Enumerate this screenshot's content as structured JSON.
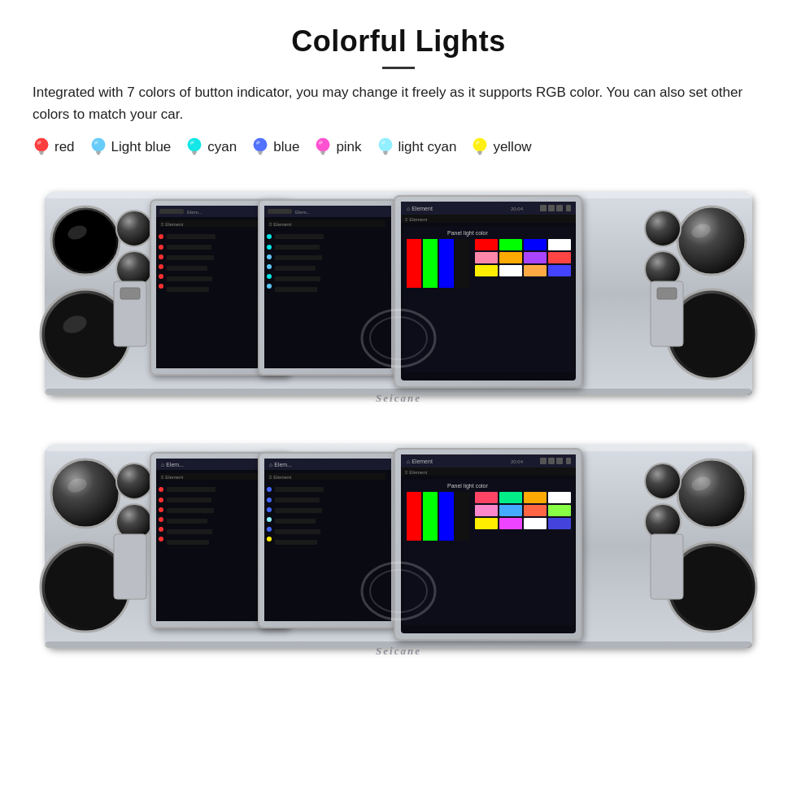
{
  "header": {
    "title": "Colorful Lights",
    "description": "Integrated with 7 colors of button indicator, you may change it freely as it supports RGB color. You can also set other colors to match your car."
  },
  "colors": [
    {
      "name": "red",
      "color": "#ff2020",
      "bulb_color": "#ff3030"
    },
    {
      "name": "Light blue",
      "color": "#5bc8fa",
      "bulb_color": "#5bc8fa"
    },
    {
      "name": "cyan",
      "color": "#00e5e5",
      "bulb_color": "#00e5e5"
    },
    {
      "name": "blue",
      "color": "#4466ff",
      "bulb_color": "#4466ff"
    },
    {
      "name": "pink",
      "color": "#ff44cc",
      "bulb_color": "#ff44cc"
    },
    {
      "name": "light cyan",
      "color": "#88eeff",
      "bulb_color": "#88eeff"
    },
    {
      "name": "yellow",
      "color": "#ffee00",
      "bulb_color": "#ffee00"
    }
  ],
  "watermark": "Seicane",
  "images": {
    "top": {
      "alt": "Car radio unit showing colorful button lights - top view"
    },
    "bottom": {
      "alt": "Car radio unit showing colorful button lights - bottom view"
    }
  }
}
